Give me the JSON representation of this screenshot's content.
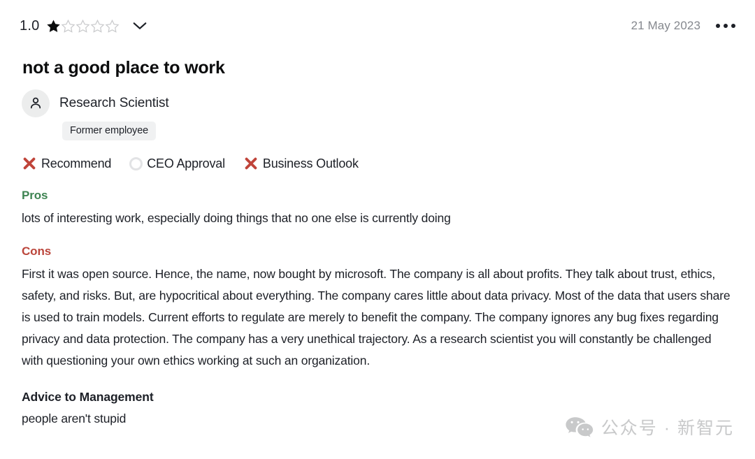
{
  "header": {
    "rating_value": "1.0",
    "rating_filled": 1,
    "rating_total": 5,
    "expand_icon": "chevron-down-icon",
    "date": "21 May 2023",
    "menu_icon": "three-dots-menu-icon"
  },
  "review": {
    "title": "not a good place to work",
    "author_role": "Research Scientist",
    "employment_badge": "Former employee",
    "avatar_icon": "person-icon"
  },
  "indicators": [
    {
      "label": "Recommend",
      "icon": "x-mark-icon",
      "state": "negative"
    },
    {
      "label": "CEO Approval",
      "icon": "circle-outline-icon",
      "state": "neutral"
    },
    {
      "label": "Business Outlook",
      "icon": "x-mark-icon",
      "state": "negative"
    }
  ],
  "sections": {
    "pros": {
      "heading": "Pros",
      "body": "lots of interesting work, especially doing things that no one else is currently doing"
    },
    "cons": {
      "heading": "Cons",
      "body": "First it was open source. Hence, the name, now bought by microsoft. The company is all about profits. They talk about trust, ethics, safety, and risks. But, are hypocritical about everything. The company cares little about data privacy. Most of the data that users share is used to train models. Current efforts to regulate are merely to benefit the company. The company ignores any bug fixes regarding privacy and data protection. The company has a very unethical trajectory. As a research scientist you will constantly be challenged with questioning your own ethics working at such an organization."
    },
    "advice": {
      "heading": "Advice to Management",
      "body": "people aren't stupid"
    }
  },
  "watermark": {
    "text": "公众号 · 新智元",
    "icon": "wechat-logo-icon"
  },
  "colors": {
    "pros_green": "#3e8452",
    "cons_red": "#bb453b",
    "x_mark_red": "#c0443a",
    "text_primary": "#1d2027",
    "text_muted": "#85888e",
    "badge_bg": "#f0f1f2",
    "watermark_gray": "#c8c9ca"
  }
}
